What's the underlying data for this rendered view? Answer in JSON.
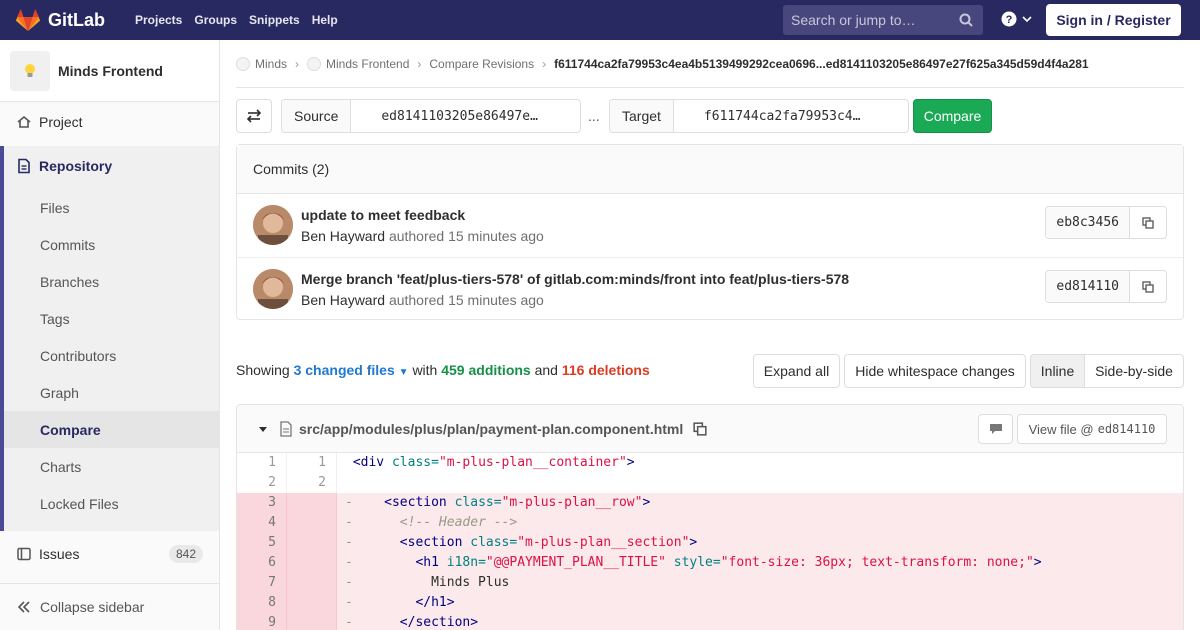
{
  "navbar": {
    "brand": "GitLab",
    "links": [
      "Projects",
      "Groups",
      "Snippets",
      "Help"
    ],
    "search_placeholder": "Search or jump to…",
    "sign_in": "Sign in / Register"
  },
  "sidebar": {
    "project_name": "Minds Frontend",
    "project": "Project",
    "repository": "Repository",
    "repo_items": [
      "Files",
      "Commits",
      "Branches",
      "Tags",
      "Contributors",
      "Graph",
      "Compare",
      "Charts",
      "Locked Files"
    ],
    "issues": "Issues",
    "issues_count": "842",
    "collapse": "Collapse sidebar"
  },
  "breadcrumb": {
    "items": [
      "Minds",
      "Minds Frontend",
      "Compare Revisions"
    ],
    "current": "f611744ca2fa79953c4ea4b5139499292cea0696...ed8141103205e86497e27f625a345d59d4f4a281"
  },
  "compare": {
    "source_label": "Source",
    "source_value": "ed8141103205e86497e…",
    "dots": "...",
    "target_label": "Target",
    "target_value": "f611744ca2fa79953c4…",
    "button": "Compare"
  },
  "commits": {
    "header": "Commits (2)",
    "items": [
      {
        "title": "update to meet feedback",
        "author": "Ben Hayward",
        "meta": "authored 15 minutes ago",
        "sha": "eb8c3456"
      },
      {
        "title": "Merge branch 'feat/plus-tiers-578' of gitlab.com:minds/front into feat/plus-tiers-578",
        "author": "Ben Hayward",
        "meta": "authored 15 minutes ago",
        "sha": "ed814110"
      }
    ]
  },
  "stats": {
    "showing": "Showing",
    "files": "3 changed files",
    "with": "with",
    "additions": "459 additions",
    "and": "and",
    "deletions": "116 deletions"
  },
  "buttons": {
    "expand_all": "Expand all",
    "hide_whitespace": "Hide whitespace changes",
    "inline": "Inline",
    "side_by_side": "Side-by-side"
  },
  "file": {
    "path": "src/app/modules/plus/plan/payment-plan.component.html",
    "view_label": "View file @",
    "view_sha": "ed814110",
    "lines": [
      {
        "old": "1",
        "new": "1"
      },
      {
        "old": "2",
        "new": "2"
      },
      {
        "old": "3",
        "new": ""
      },
      {
        "old": "4",
        "new": ""
      },
      {
        "old": "5",
        "new": ""
      },
      {
        "old": "6",
        "new": ""
      },
      {
        "old": "7",
        "new": ""
      },
      {
        "old": "8",
        "new": ""
      },
      {
        "old": "9",
        "new": ""
      }
    ]
  },
  "colors": {
    "navbar": "#292961",
    "compare_button": "#1aaa55",
    "additions": "#168f48",
    "deletions": "#db3b21",
    "link": "#1f78d1"
  }
}
